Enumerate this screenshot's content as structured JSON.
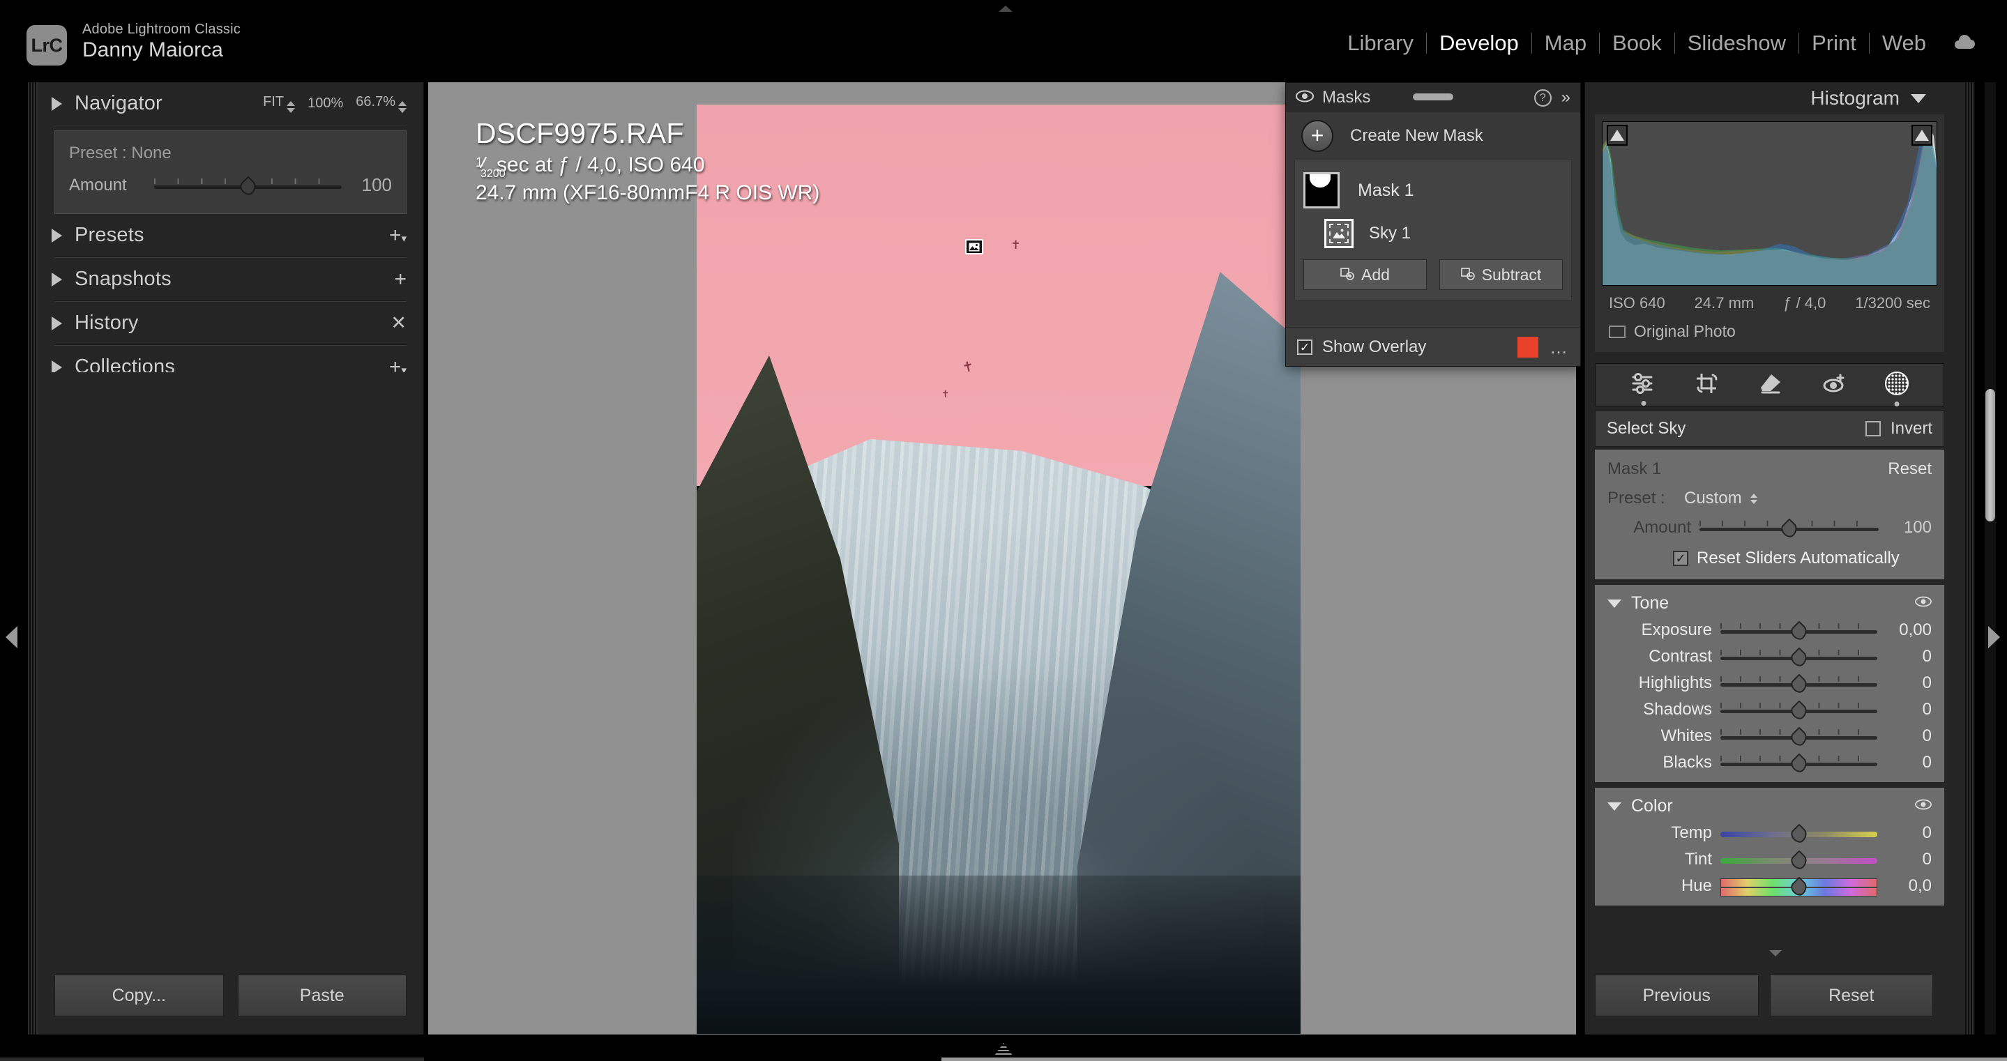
{
  "app": {
    "logo_text": "LrC",
    "name": "Adobe Lightroom Classic",
    "user": "Danny Maiorca"
  },
  "modules": [
    {
      "label": "Library",
      "active": false
    },
    {
      "label": "Develop",
      "active": true
    },
    {
      "label": "Map",
      "active": false
    },
    {
      "label": "Book",
      "active": false
    },
    {
      "label": "Slideshow",
      "active": false
    },
    {
      "label": "Print",
      "active": false
    },
    {
      "label": "Web",
      "active": false
    }
  ],
  "cloud_icon": "cloud-sync-icon",
  "left_panel": {
    "navigator": {
      "title": "Navigator",
      "fit_label": "FIT",
      "zoom_100": "100%",
      "zoom_custom": "66.7%"
    },
    "preset_box": {
      "preset_label": "Preset : None",
      "amount_label": "Amount",
      "amount_value": "100"
    },
    "sections": [
      {
        "title": "Presets",
        "action": "plus-dropdown-icon"
      },
      {
        "title": "Snapshots",
        "action": "plus-icon"
      },
      {
        "title": "History",
        "action": "close-icon"
      },
      {
        "title": "Collections",
        "action": "plus-dropdown-icon"
      }
    ],
    "copy_button": "Copy...",
    "paste_button": "Paste"
  },
  "canvas": {
    "info_overlay": {
      "filename": "DSCF9975.RAF",
      "shutter_numerator": "1",
      "shutter_denominator": "3200",
      "exposure_line": "sec at ƒ / 4,0, ISO 640",
      "lens_line": "24.7 mm (XF16-80mmF4 R OIS WR)"
    },
    "background_color": "#919191",
    "sky_overlay_color": "#f0a3ac"
  },
  "masks_panel": {
    "title": "Masks",
    "eye_icon": "eye-icon",
    "help_icon": "help-icon",
    "collapse_icon": "double-chevron-right-icon",
    "create_new_mask": "Create New Mask",
    "masks": [
      {
        "name": "Mask 1",
        "thumb": "mask-thumbnail"
      }
    ],
    "sub_masks": [
      {
        "name": "Sky 1",
        "icon": "sky-select-icon"
      }
    ],
    "add_button": "Add",
    "subtract_button": "Subtract",
    "show_overlay_label": "Show Overlay",
    "show_overlay_checked": true,
    "overlay_color": "#e8432a",
    "more_icon": "ellipsis-icon"
  },
  "right_panel": {
    "histogram": {
      "title": "Histogram",
      "iso": "ISO 640",
      "focal": "24.7 mm",
      "aperture": "ƒ / 4,0",
      "shutter": "1/3200 sec",
      "original_photo": "Original Photo"
    },
    "tools": [
      {
        "name": "adjust-sliders-icon",
        "active": false,
        "dot": true
      },
      {
        "name": "crop-icon",
        "active": false,
        "dot": false
      },
      {
        "name": "spot-removal-icon",
        "active": false,
        "dot": false
      },
      {
        "name": "red-eye-icon",
        "active": false,
        "dot": false
      },
      {
        "name": "masking-icon",
        "active": true,
        "dot": true
      }
    ],
    "select_sky": {
      "label": "Select Sky",
      "invert_label": "Invert",
      "invert_checked": false
    },
    "mask_settings": {
      "mask_name": "Mask 1",
      "reset_label": "Reset",
      "preset_key": "Preset :",
      "preset_value": "Custom",
      "amount_label": "Amount",
      "amount_value": "100",
      "reset_sliders_label": "Reset Sliders Automatically",
      "reset_sliders_checked": true
    },
    "tone": {
      "title": "Tone",
      "sliders": [
        {
          "label": "Exposure",
          "value": "0,00",
          "pos": 50
        },
        {
          "label": "Contrast",
          "value": "0",
          "pos": 50
        },
        {
          "label": "Highlights",
          "value": "0",
          "pos": 50
        },
        {
          "label": "Shadows",
          "value": "0",
          "pos": 50
        },
        {
          "label": "Whites",
          "value": "0",
          "pos": 50
        },
        {
          "label": "Blacks",
          "value": "0",
          "pos": 50
        }
      ]
    },
    "color": {
      "title": "Color",
      "sliders": [
        {
          "label": "Temp",
          "value": "0",
          "pos": 50
        },
        {
          "label": "Tint",
          "value": "0",
          "pos": 50
        },
        {
          "label": "Hue",
          "value": "0,0",
          "pos": 50
        }
      ]
    },
    "previous_button": "Previous",
    "reset_button": "Reset"
  }
}
